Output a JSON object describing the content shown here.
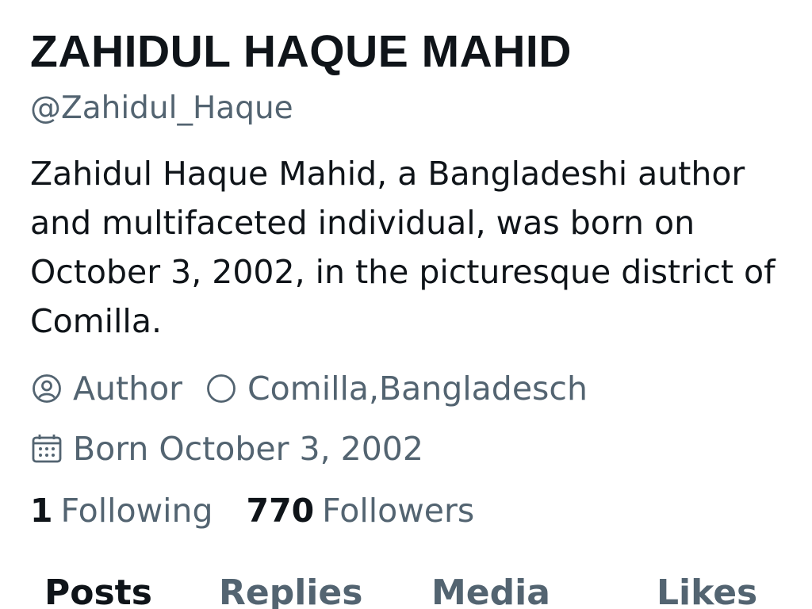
{
  "profile": {
    "display_name": "ZAHIDUL HAQUE MAHID",
    "handle": "@Zahidul_Haque",
    "bio": "Zahidul Haque Mahid, a Bangladeshi author and multifaceted individual, was born on October 3, 2002, in the picturesque district of Comilla.",
    "category": "Author",
    "location": "Comilla,Bangladesch",
    "birth": "Born October 3, 2002"
  },
  "stats": {
    "following_count": "1",
    "following_label": "Following",
    "followers_count": "770",
    "followers_label": "Followers"
  },
  "tabs": [
    {
      "label": "Posts",
      "active": true
    },
    {
      "label": "Replies",
      "active": false
    },
    {
      "label": "Media",
      "active": false
    },
    {
      "label": "Likes",
      "active": false
    }
  ],
  "icons": {
    "category": "professional-category-icon",
    "location": "location-icon",
    "birth": "calendar-icon"
  },
  "colors": {
    "primary_text": "#0f1419",
    "secondary_text": "#536471",
    "background": "#ffffff"
  }
}
